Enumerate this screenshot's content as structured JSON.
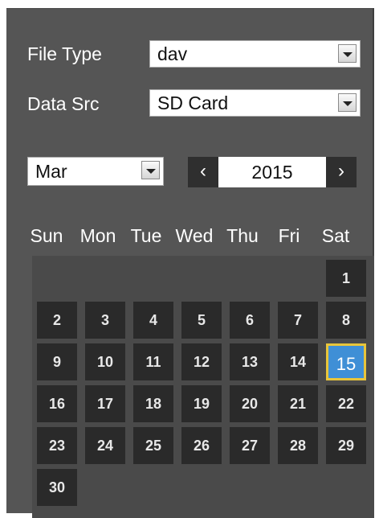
{
  "filters": {
    "file_type_label": "File Type",
    "file_type_value": "dav",
    "data_src_label": "Data Src",
    "data_src_value": "SD Card"
  },
  "calendar": {
    "month_value": "Mar",
    "year": "2015",
    "prev_icon": "‹",
    "next_icon": "›",
    "weekdays": [
      "Sun",
      "Mon",
      "Tue",
      "Wed",
      "Thu",
      "Fri",
      "Sat"
    ],
    "first_weekday_index": 6,
    "days_in_month": 30,
    "selected_day": 15,
    "selected_day_color": "#3f8fd6",
    "selected_border_color": "#e8c53a"
  }
}
